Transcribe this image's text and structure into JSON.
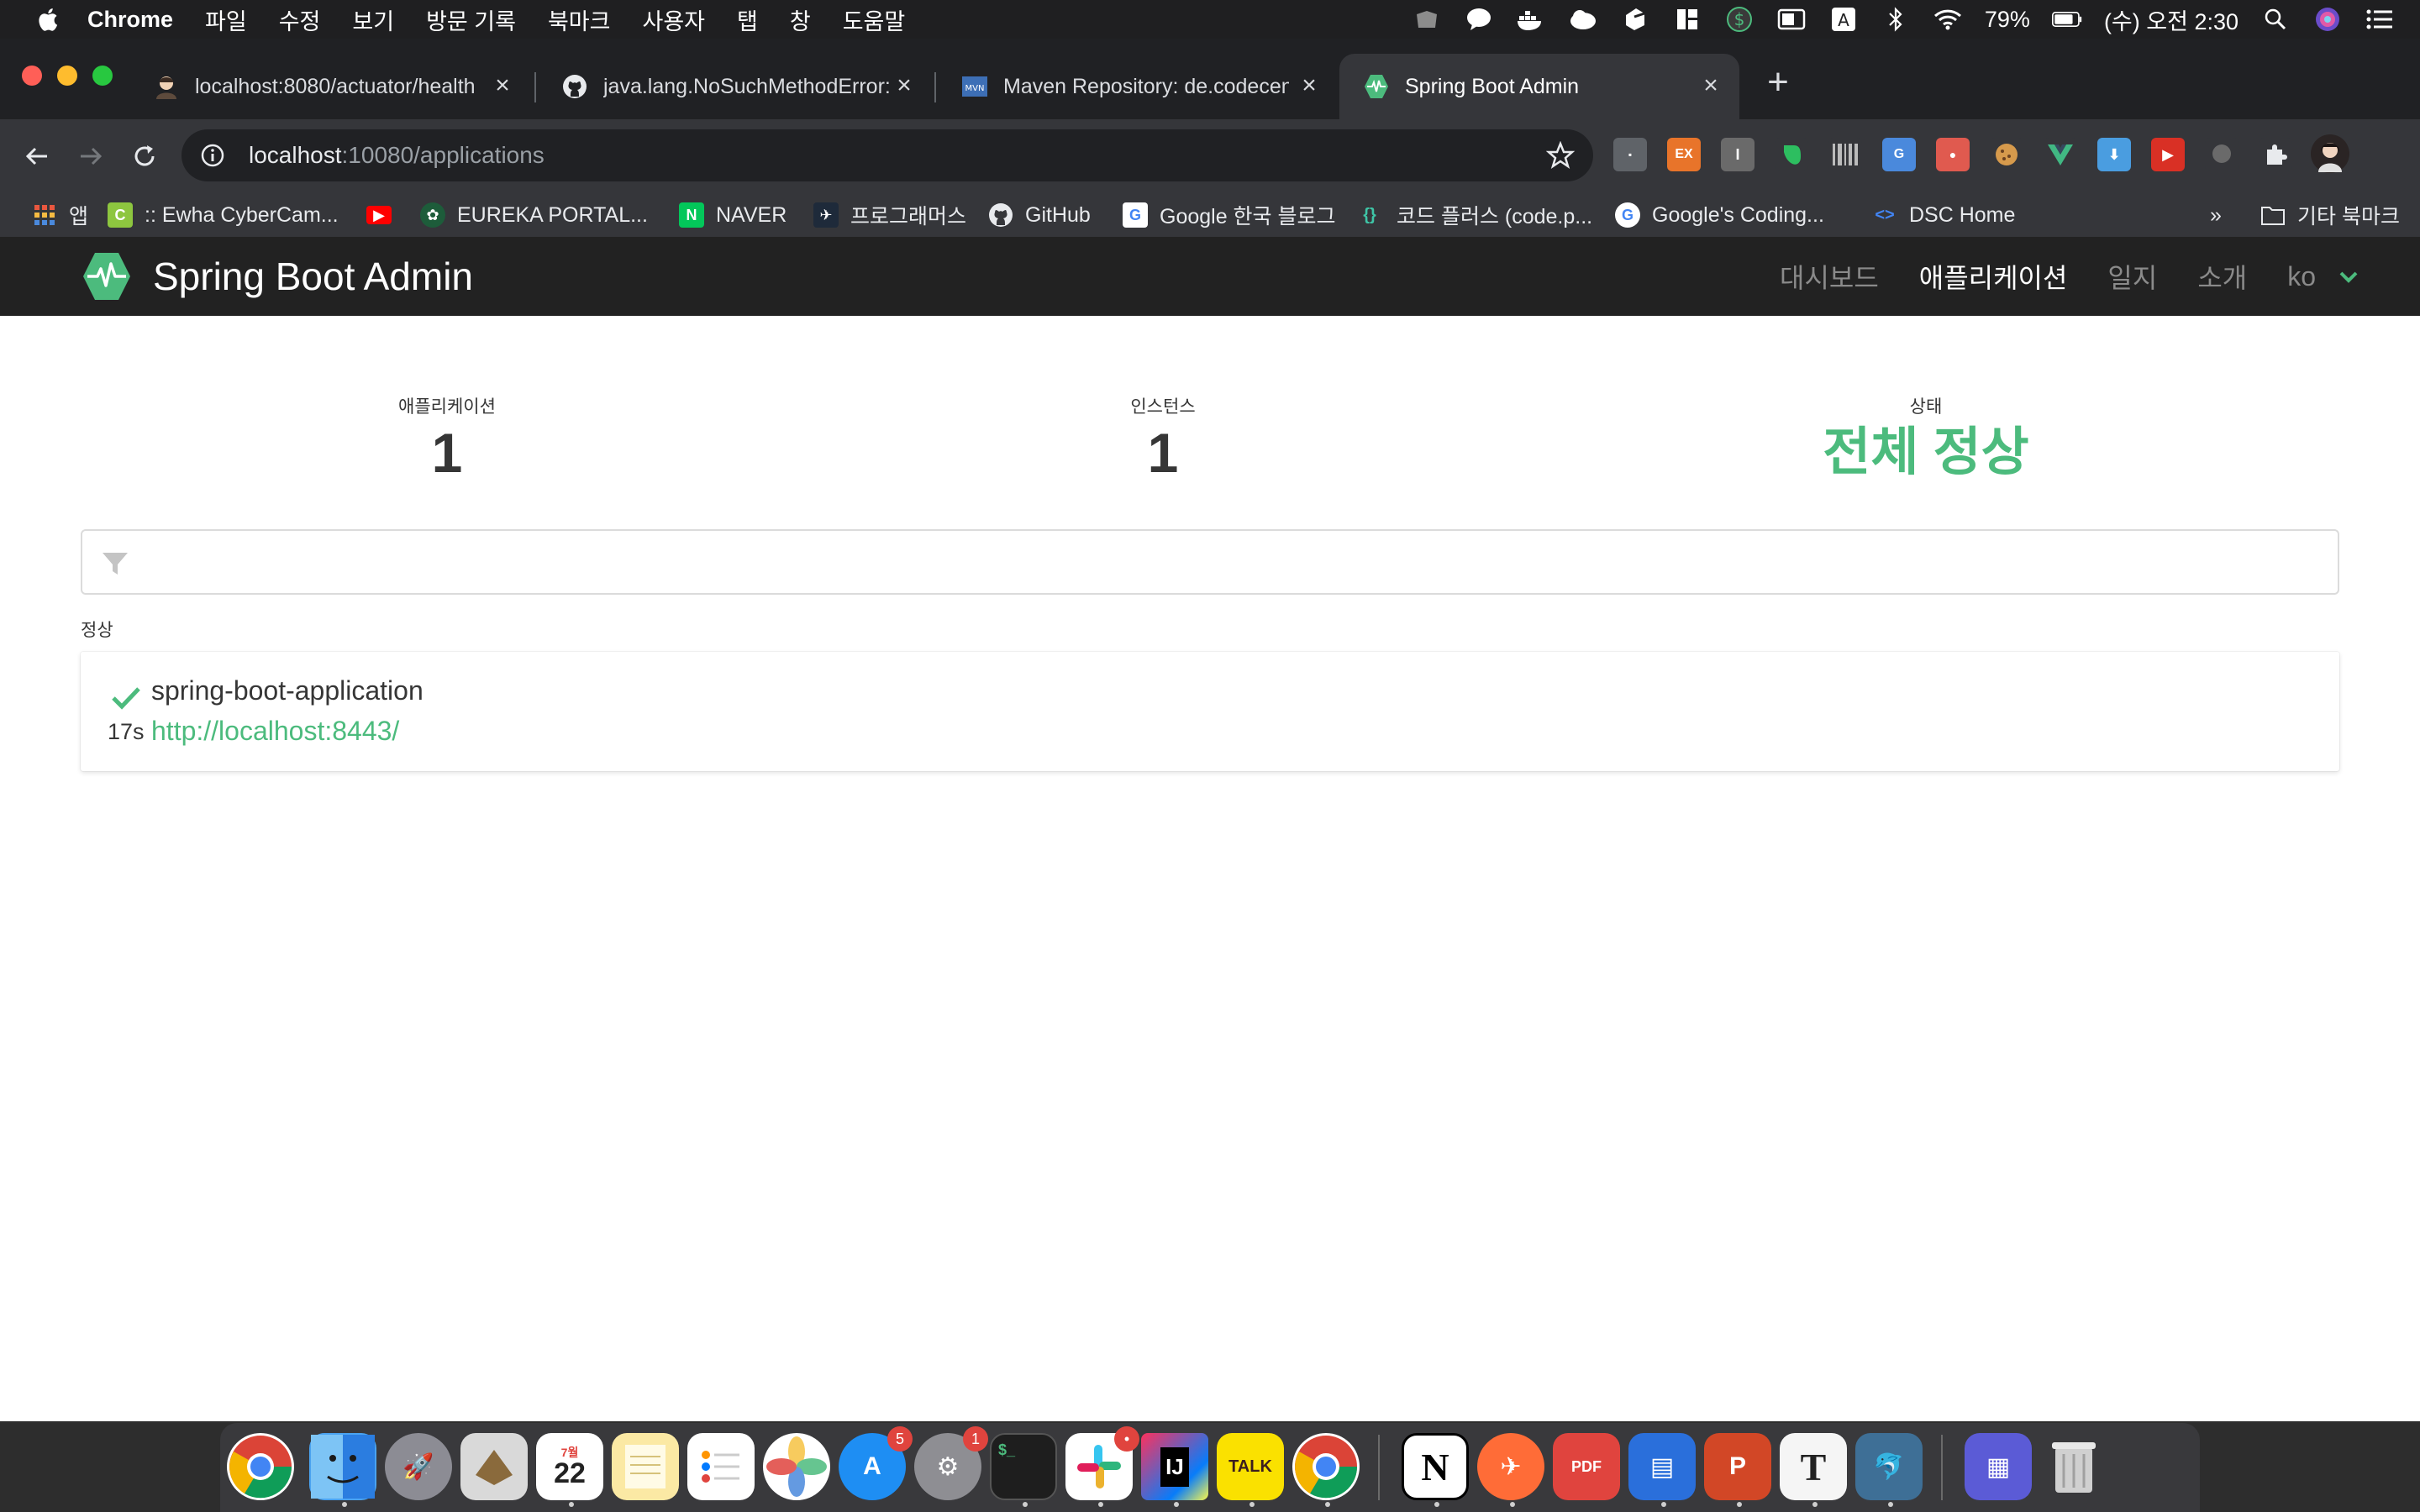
{
  "menubar": {
    "items": [
      "Chrome",
      "파일",
      "수정",
      "보기",
      "방문 기록",
      "북마크",
      "사용자",
      "탭",
      "창",
      "도움말"
    ],
    "battery": "79%",
    "clock": "(수) 오전 2:30"
  },
  "tabs": [
    {
      "title": "localhost:8080/actuator/health",
      "icon": "avatar-favicon"
    },
    {
      "title": "java.lang.NoSuchMethodError:",
      "icon": "github-icon"
    },
    {
      "title": "Maven Repository: de.codecentr",
      "icon": "mvn-icon"
    },
    {
      "title": "Spring Boot Admin",
      "icon": "sba-pulse-icon",
      "active": true
    }
  ],
  "address": {
    "host": "localhost",
    "rest": ":10080/applications"
  },
  "bookmarks": {
    "apps": "앱",
    "items": [
      ":: Ewha CyberCam...",
      "EUREKA PORTAL...",
      "NAVER",
      "프로그래머스",
      "GitHub",
      "Google 한국 블로그",
      "코드 플러스 (code.p...",
      "Google's Coding...",
      "DSC Home"
    ],
    "more": "»",
    "other": "기타 북마크"
  },
  "sba": {
    "brand": "Spring Boot Admin",
    "nav": [
      "대시보드",
      "애플리케이션",
      "일지",
      "소개"
    ],
    "active_nav": 1,
    "lang": "ko",
    "stats": {
      "apps_label": "애플리케이션",
      "apps_value": "1",
      "instances_label": "인스턴스",
      "instances_value": "1",
      "status_label": "상태",
      "status_value": "전체 정상"
    },
    "filter_placeholder": "",
    "group_label": "정상",
    "application": {
      "name": "spring-boot-application",
      "url": "http://localhost:8443/",
      "age": "17s",
      "status": "UP"
    },
    "colors": {
      "accent": "#4cbb7d",
      "navbar": "#222222"
    }
  },
  "dock": {
    "badges": {
      "appstore": "5",
      "prefs": "1",
      "slack": "•"
    },
    "calendar": {
      "month": "7월",
      "day": "22"
    },
    "labels": {
      "intellij": "IJ",
      "kakao": "TALK",
      "notion": "N",
      "powerpoint": "P",
      "textedit": "T",
      "pdf": "PDF"
    }
  }
}
